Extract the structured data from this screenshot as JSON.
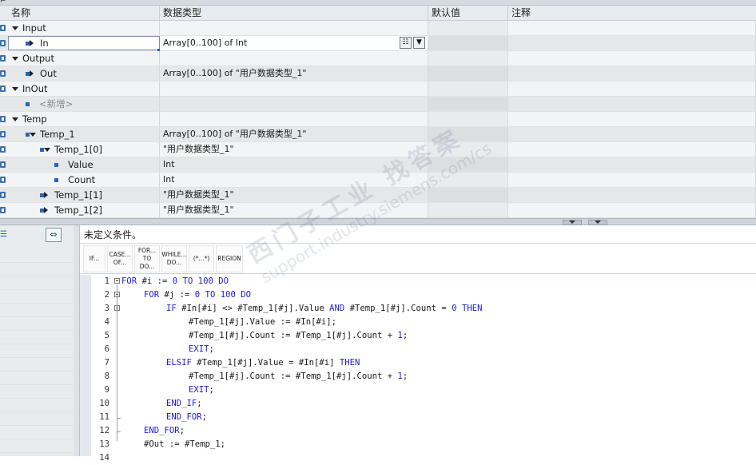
{
  "table": {
    "columns": [
      "名称",
      "数据类型",
      "默认值",
      "注释"
    ],
    "rows": [
      {
        "name": "Input",
        "type": "",
        "level": 0,
        "expand": "down",
        "icon": true,
        "bullet": false
      },
      {
        "name": "In",
        "type": "Array[0..100] of Int",
        "level": 1,
        "expand": "right",
        "icon": true,
        "bullet": true,
        "selected": true
      },
      {
        "name": "Output",
        "type": "",
        "level": 0,
        "expand": "down",
        "icon": true,
        "bullet": false
      },
      {
        "name": "Out",
        "type": "Array[0..100] of \"用户数据类型_1\"",
        "level": 1,
        "expand": "right",
        "icon": true,
        "bullet": true
      },
      {
        "name": "InOut",
        "type": "",
        "level": 0,
        "expand": "down",
        "icon": true,
        "bullet": false
      },
      {
        "name": "<新增>",
        "type": "",
        "level": 1,
        "expand": "none",
        "icon": false,
        "bullet": true,
        "hint": true
      },
      {
        "name": "Temp",
        "type": "",
        "level": 0,
        "expand": "down",
        "icon": true,
        "bullet": false
      },
      {
        "name": "Temp_1",
        "type": "Array[0..100] of \"用户数据类型_1\"",
        "level": 1,
        "expand": "down",
        "icon": true,
        "bullet": true
      },
      {
        "name": "Temp_1[0]",
        "type": "\"用户数据类型_1\"",
        "level": 2,
        "expand": "down",
        "icon": true,
        "bullet": true
      },
      {
        "name": "Value",
        "type": "Int",
        "level": 3,
        "expand": "none",
        "icon": true,
        "bullet": true
      },
      {
        "name": "Count",
        "type": "Int",
        "level": 3,
        "expand": "none",
        "icon": true,
        "bullet": true
      },
      {
        "name": "Temp_1[1]",
        "type": "\"用户数据类型_1\"",
        "level": 2,
        "expand": "right",
        "icon": true,
        "bullet": true
      },
      {
        "name": "Temp_1[2]",
        "type": "\"用户数据类型_1\"",
        "level": 2,
        "expand": "right",
        "icon": true,
        "bullet": true
      }
    ],
    "cell_button_list": "☷",
    "cell_button_dropdown": "▼"
  },
  "editor": {
    "condition_text": "未定义条件。",
    "toolbar": [
      {
        "label": "IF...",
        "name": "if"
      },
      {
        "label": "CASE... OF...",
        "name": "case-of"
      },
      {
        "label": "FOR... TO DO...",
        "name": "for-to-do"
      },
      {
        "label": "WHILE... DO...",
        "name": "while-do"
      },
      {
        "label": "(*...*)",
        "name": "comment"
      },
      {
        "label": "REGION",
        "name": "region"
      }
    ],
    "lines": [
      {
        "n": "1",
        "indent": 0,
        "fold": true,
        "tokens": [
          [
            "kw",
            "FOR"
          ],
          [
            "t",
            " #i := "
          ],
          [
            "num",
            "0"
          ],
          [
            "t",
            " "
          ],
          [
            "kw",
            "TO"
          ],
          [
            "t",
            " "
          ],
          [
            "num",
            "100"
          ],
          [
            "t",
            " "
          ],
          [
            "kw",
            "DO"
          ]
        ]
      },
      {
        "n": "2",
        "indent": 1,
        "fold": true,
        "tokens": [
          [
            "kw",
            "FOR"
          ],
          [
            "t",
            " #j := "
          ],
          [
            "num",
            "0"
          ],
          [
            "t",
            " "
          ],
          [
            "kw",
            "TO"
          ],
          [
            "t",
            " "
          ],
          [
            "num",
            "100"
          ],
          [
            "t",
            " "
          ],
          [
            "kw",
            "DO"
          ]
        ]
      },
      {
        "n": "3",
        "indent": 2,
        "fold": true,
        "tokens": [
          [
            "kw",
            "IF"
          ],
          [
            "t",
            " #In[#i] <> #Temp_1[#j].Value "
          ],
          [
            "kw",
            "AND"
          ],
          [
            "t",
            " #Temp_1[#j].Count = "
          ],
          [
            "num",
            "0"
          ],
          [
            "t",
            " "
          ],
          [
            "kw",
            "THEN"
          ]
        ]
      },
      {
        "n": "4",
        "indent": 3,
        "fold": false,
        "tokens": [
          [
            "t",
            "#Temp_1[#j].Value := #In[#i];"
          ]
        ]
      },
      {
        "n": "5",
        "indent": 3,
        "fold": false,
        "tokens": [
          [
            "t",
            "#Temp_1[#j].Count := #Temp_1[#j].Count + "
          ],
          [
            "num",
            "1"
          ],
          [
            "t",
            ";"
          ]
        ]
      },
      {
        "n": "6",
        "indent": 3,
        "fold": false,
        "tokens": [
          [
            "kw",
            "EXIT"
          ],
          [
            "t",
            ";"
          ]
        ]
      },
      {
        "n": "7",
        "indent": 2,
        "fold": false,
        "tokens": [
          [
            "kw",
            "ELSIF"
          ],
          [
            "t",
            " #Temp_1[#j].Value = #In[#i] "
          ],
          [
            "kw",
            "THEN"
          ]
        ]
      },
      {
        "n": "8",
        "indent": 3,
        "fold": false,
        "tokens": [
          [
            "t",
            "#Temp_1[#j].Count := #Temp_1[#j].Count + "
          ],
          [
            "num",
            "1"
          ],
          [
            "t",
            ";"
          ]
        ]
      },
      {
        "n": "9",
        "indent": 3,
        "fold": false,
        "tokens": [
          [
            "kw",
            "EXIT"
          ],
          [
            "t",
            ";"
          ]
        ]
      },
      {
        "n": "10",
        "indent": 2,
        "fold": false,
        "tokens": [
          [
            "kw",
            "END_IF"
          ],
          [
            "t",
            ";"
          ]
        ]
      },
      {
        "n": "11",
        "indent": 2,
        "fold": false,
        "tokens": [
          [
            "kw",
            "END_FOR"
          ],
          [
            "t",
            ";"
          ]
        ]
      },
      {
        "n": "12",
        "indent": 1,
        "fold": false,
        "tokens": [
          [
            "kw",
            "END_FOR"
          ],
          [
            "t",
            ";"
          ]
        ]
      },
      {
        "n": "13",
        "indent": 1,
        "fold": false,
        "tokens": [
          [
            "t",
            "#Out := #Temp_1;"
          ]
        ]
      },
      {
        "n": "14",
        "indent": 0,
        "fold": false,
        "tokens": []
      }
    ]
  },
  "watermark": {
    "line1": "西门子工业  找答案",
    "line2": "support.industry.siemens.com/cs"
  },
  "ui": {
    "swap_glyph": "⇔",
    "list_glyph": "☰",
    "splitter_glyph": "▼",
    "top_glyph": "⌐"
  }
}
